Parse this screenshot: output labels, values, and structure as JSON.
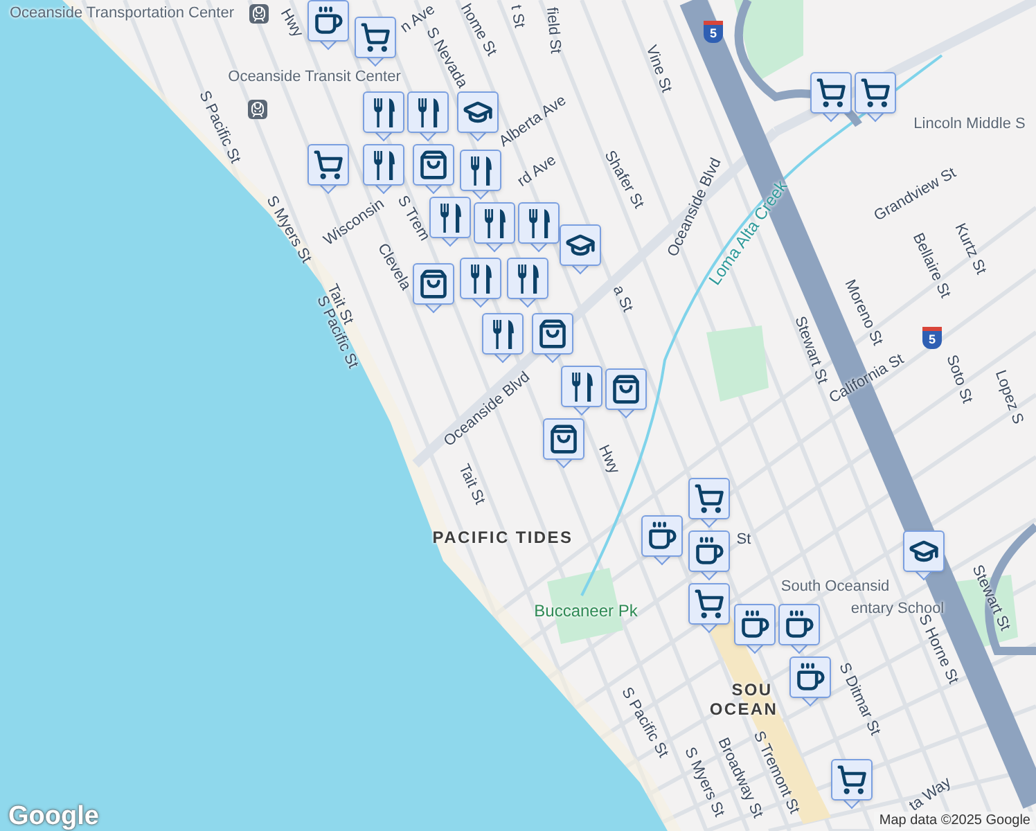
{
  "labels": [
    {
      "text": "Oceanside Transportation Center",
      "kind": "place"
    },
    {
      "text": "Oceanside Transit Center",
      "kind": "place"
    },
    {
      "text": "Hwy",
      "kind": "street"
    },
    {
      "text": "n Ave",
      "kind": "street"
    },
    {
      "text": "home St",
      "kind": "street"
    },
    {
      "text": "t St",
      "kind": "street"
    },
    {
      "text": "field St",
      "kind": "street"
    },
    {
      "text": "Vine St",
      "kind": "street"
    },
    {
      "text": "S Nevada",
      "kind": "street"
    },
    {
      "text": "Alberta Ave",
      "kind": "street"
    },
    {
      "text": "rd Ave",
      "kind": "street"
    },
    {
      "text": "Shafer St",
      "kind": "street"
    },
    {
      "text": "Oceanside Blvd",
      "kind": "street"
    },
    {
      "text": "Loma Alta Creek",
      "kind": "creek"
    },
    {
      "text": "Lincoln Middle S",
      "kind": "place"
    },
    {
      "text": "Grandview St",
      "kind": "street"
    },
    {
      "text": "Kurtz St",
      "kind": "street"
    },
    {
      "text": "Bellaire St",
      "kind": "street"
    },
    {
      "text": "Moreno St",
      "kind": "street"
    },
    {
      "text": "Stewart St",
      "kind": "street"
    },
    {
      "text": "California St",
      "kind": "street"
    },
    {
      "text": "Soto St",
      "kind": "street"
    },
    {
      "text": "Lopez S",
      "kind": "street"
    },
    {
      "text": "S Pacific St",
      "kind": "street"
    },
    {
      "text": "S Myers St",
      "kind": "street"
    },
    {
      "text": "Wisconsin",
      "kind": "street"
    },
    {
      "text": "S Trem",
      "kind": "street"
    },
    {
      "text": "Clevela",
      "kind": "street"
    },
    {
      "text": "Tait St",
      "kind": "street"
    },
    {
      "text": "S Pacific St",
      "kind": "street"
    },
    {
      "text": "a St",
      "kind": "street"
    },
    {
      "text": "Oceanside Blvd",
      "kind": "street"
    },
    {
      "text": "Hwy",
      "kind": "street"
    },
    {
      "text": "Tait St",
      "kind": "street"
    },
    {
      "text": "PACIFIC TIDES",
      "kind": "district"
    },
    {
      "text": "Buccaneer Pk",
      "kind": "park"
    },
    {
      "text": "St",
      "kind": "street"
    },
    {
      "text": "South Oceansid",
      "kind": "place"
    },
    {
      "text": "entary School",
      "kind": "place"
    },
    {
      "text": "Stewart St",
      "kind": "street"
    },
    {
      "text": "S Horne St",
      "kind": "street"
    },
    {
      "text": "S Ditmar St",
      "kind": "street"
    },
    {
      "text": "SOU",
      "kind": "district"
    },
    {
      "text": "OCEAN",
      "kind": "district"
    },
    {
      "text": "S Tremont St",
      "kind": "street"
    },
    {
      "text": "Broadway St",
      "kind": "street"
    },
    {
      "text": "S Myers St",
      "kind": "street"
    },
    {
      "text": "S Pacific St",
      "kind": "street"
    },
    {
      "text": "ta Way",
      "kind": "street"
    }
  ],
  "shields": [
    "5",
    "5"
  ],
  "markers": [
    {
      "kind": "coffee"
    },
    {
      "kind": "cart"
    },
    {
      "kind": "cart"
    },
    {
      "kind": "cart"
    },
    {
      "kind": "food"
    },
    {
      "kind": "food"
    },
    {
      "kind": "food"
    },
    {
      "kind": "school"
    },
    {
      "kind": "cart"
    },
    {
      "kind": "bag"
    },
    {
      "kind": "food"
    },
    {
      "kind": "food"
    },
    {
      "kind": "food"
    },
    {
      "kind": "food"
    },
    {
      "kind": "school"
    },
    {
      "kind": "bag"
    },
    {
      "kind": "food"
    },
    {
      "kind": "food"
    },
    {
      "kind": "food"
    },
    {
      "kind": "bag"
    },
    {
      "kind": "food"
    },
    {
      "kind": "bag"
    },
    {
      "kind": "bag"
    },
    {
      "kind": "cart"
    },
    {
      "kind": "coffee"
    },
    {
      "kind": "coffee"
    },
    {
      "kind": "cart"
    },
    {
      "kind": "coffee"
    },
    {
      "kind": "coffee"
    },
    {
      "kind": "coffee"
    },
    {
      "kind": "school"
    },
    {
      "kind": "cart"
    }
  ],
  "logo": "Google",
  "attribution": "Map data ©2025 Google"
}
